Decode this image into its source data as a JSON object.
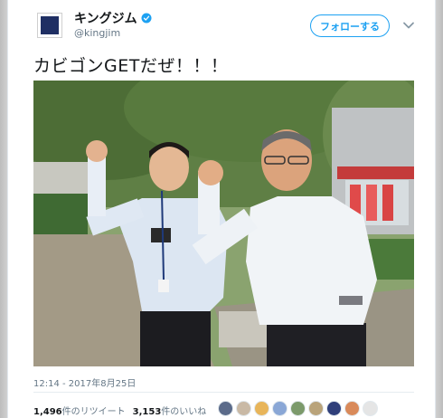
{
  "tweet": {
    "display_name": "キングジム",
    "handle": "@kingjim",
    "follow_label": "フォローする",
    "text": "カビゴンGETだぜ！！！",
    "timestamp": "12:14 - 2017年8月25日",
    "retweets_count": "1,496",
    "retweets_label": "件のリツイート",
    "likes_count": "3,153",
    "likes_label": "件のいいね"
  },
  "colors": {
    "brand_blue": "#1da1f2",
    "avatar_navy": "#1f2f63",
    "text": "#14171a",
    "muted": "#657786"
  },
  "icons": {
    "verified": "verified-badge-icon",
    "menu": "chevron-down-icon"
  },
  "likers": [
    {
      "color": "#5b6b8a"
    },
    {
      "color": "#c9b9a5"
    },
    {
      "color": "#e8b55a"
    },
    {
      "color": "#8aa7d6"
    },
    {
      "color": "#7c9a6b"
    },
    {
      "color": "#b9a37a"
    },
    {
      "color": "#2f3f7a"
    },
    {
      "color": "#d98a5a"
    },
    {
      "color": "#e5e5e5"
    }
  ]
}
